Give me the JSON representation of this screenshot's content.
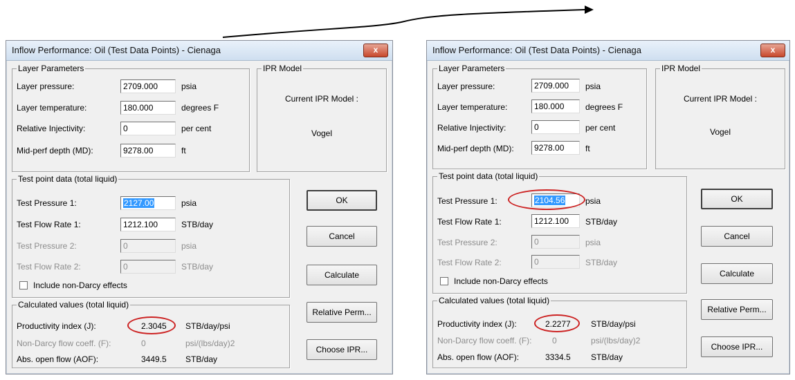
{
  "dialogs": [
    {
      "title": "Inflow Performance: Oil (Test Data Points) - Cienaga",
      "layer_group": "Layer Parameters",
      "layer_pressure_label": "Layer pressure:",
      "layer_pressure_value": "2709.000",
      "layer_pressure_unit": "psia",
      "layer_temperature_label": "Layer temperature:",
      "layer_temperature_value": "180.000",
      "layer_temperature_unit": "degrees F",
      "relative_injectivity_label": "Relative Injectivity:",
      "relative_injectivity_value": "0",
      "relative_injectivity_unit": "per cent",
      "midperf_label": "Mid-perf depth (MD):",
      "midperf_value": "9278.00",
      "midperf_unit": "ft",
      "ipr_group": "IPR Model",
      "ipr_current_label": "Current IPR Model :",
      "ipr_current_value": "Vogel",
      "test_group": "Test point data (total liquid)",
      "test_pressure1_label": "Test Pressure 1:",
      "test_pressure1_value": "2127.00",
      "test_pressure1_unit": "psia",
      "test_flow1_label": "Test Flow Rate 1:",
      "test_flow1_value": "1212.100",
      "test_flow1_unit": "STB/day",
      "test_pressure2_label": "Test Pressure 2:",
      "test_pressure2_value": "0",
      "test_pressure2_unit": "psia",
      "test_flow2_label": "Test Flow Rate 2:",
      "test_flow2_value": "0",
      "test_flow2_unit": "STB/day",
      "non_darcy_checkbox_label": "Include non-Darcy effects",
      "calc_group": "Calculated values (total liquid)",
      "pi_label": "Productivity index (J):",
      "pi_value": "2.3045",
      "pi_unit": "STB/day/psi",
      "nd_coeff_label": "Non-Darcy flow coeff. (F):",
      "nd_coeff_value": "0",
      "nd_coeff_unit": "psi/(lbs/day)2",
      "aof_label": "Abs. open flow (AOF):",
      "aof_value": "3449.5",
      "aof_unit": "STB/day",
      "ok_label": "OK",
      "cancel_label": "Cancel",
      "calculate_label": "Calculate",
      "relperm_label": "Relative Perm...",
      "choose_ipr_label": "Choose IPR...",
      "close_glyph": "x"
    },
    {
      "title": "Inflow Performance: Oil (Test Data Points) - Cienaga",
      "layer_group": "Layer Parameters",
      "layer_pressure_label": "Layer pressure:",
      "layer_pressure_value": "2709.000",
      "layer_pressure_unit": "psia",
      "layer_temperature_label": "Layer temperature:",
      "layer_temperature_value": "180.000",
      "layer_temperature_unit": "degrees F",
      "relative_injectivity_label": "Relative Injectivity:",
      "relative_injectivity_value": "0",
      "relative_injectivity_unit": "per cent",
      "midperf_label": "Mid-perf depth (MD):",
      "midperf_value": "9278.00",
      "midperf_unit": "ft",
      "ipr_group": "IPR Model",
      "ipr_current_label": "Current IPR Model :",
      "ipr_current_value": "Vogel",
      "test_group": "Test point data (total liquid)",
      "test_pressure1_label": "Test Pressure 1:",
      "test_pressure1_value": "2104.56",
      "test_pressure1_unit": "psia",
      "test_flow1_label": "Test Flow Rate 1:",
      "test_flow1_value": "1212.100",
      "test_flow1_unit": "STB/day",
      "test_pressure2_label": "Test Pressure 2:",
      "test_pressure2_value": "0",
      "test_pressure2_unit": "psia",
      "test_flow2_label": "Test Flow Rate 2:",
      "test_flow2_value": "0",
      "test_flow2_unit": "STB/day",
      "non_darcy_checkbox_label": "Include non-Darcy effects",
      "calc_group": "Calculated values (total liquid)",
      "pi_label": "Productivity index (J):",
      "pi_value": "2.2277",
      "pi_unit": "STB/day/psi",
      "nd_coeff_label": "Non-Darcy flow coeff. (F):",
      "nd_coeff_value": "0",
      "nd_coeff_unit": "psi/(lbs/day)2",
      "aof_label": "Abs. open flow (AOF):",
      "aof_value": "3334.5",
      "aof_unit": "STB/day",
      "ok_label": "OK",
      "cancel_label": "Cancel",
      "calculate_label": "Calculate",
      "relperm_label": "Relative Perm...",
      "choose_ipr_label": "Choose IPR...",
      "close_glyph": "x"
    }
  ],
  "colors": {
    "highlight_oval": "#cc2222",
    "selection": "#3399ff",
    "dialog_bg": "#f0f0f0"
  }
}
